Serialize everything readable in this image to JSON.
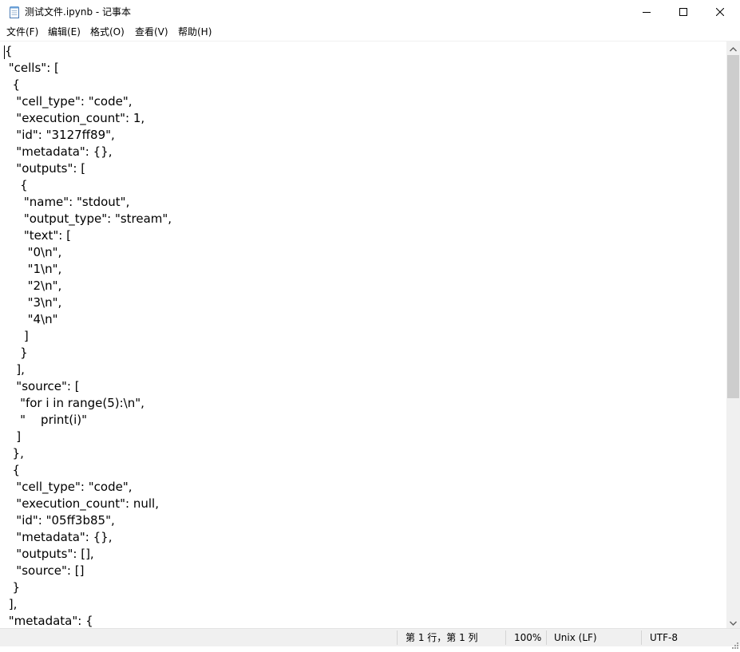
{
  "window": {
    "title": "测试文件.ipynb - 记事本",
    "app_icon": "notepad-icon",
    "controls": [
      "minimize-icon",
      "maximize-icon",
      "close-icon"
    ]
  },
  "menu": {
    "items": [
      {
        "label": "文件(F)"
      },
      {
        "label": "编辑(E)"
      },
      {
        "label": "格式(O)"
      },
      {
        "label": "查看(V)"
      },
      {
        "label": "帮助(H)"
      }
    ]
  },
  "editor": {
    "content": "{\n \"cells\": [\n  {\n   \"cell_type\": \"code\",\n   \"execution_count\": 1,\n   \"id\": \"3127ff89\",\n   \"metadata\": {},\n   \"outputs\": [\n    {\n     \"name\": \"stdout\",\n     \"output_type\": \"stream\",\n     \"text\": [\n      \"0\\n\",\n      \"1\\n\",\n      \"2\\n\",\n      \"3\\n\",\n      \"4\\n\"\n     ]\n    }\n   ],\n   \"source\": [\n    \"for i in range(5):\\n\",\n    \"    print(i)\"\n   ]\n  },\n  {\n   \"cell_type\": \"code\",\n   \"execution_count\": null,\n   \"id\": \"05ff3b85\",\n   \"metadata\": {},\n   \"outputs\": [],\n   \"source\": []\n  }\n ],\n \"metadata\": {"
  },
  "status": {
    "position": "第 1 行，第 1 列",
    "zoom": "100%",
    "line_ending": "Unix (LF)",
    "encoding": "UTF-8"
  },
  "colors": {
    "status_bg": "#f0f0f0",
    "scroll_thumb": "#cdcdcd",
    "text": "#000000"
  }
}
